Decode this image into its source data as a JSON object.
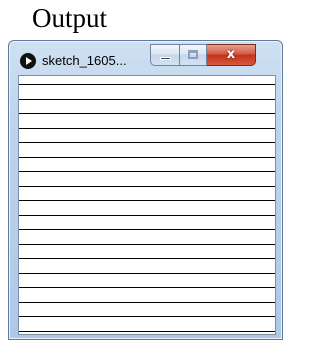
{
  "page": {
    "heading": "Output"
  },
  "window": {
    "title": "sketch_1605...",
    "app_icon": "play-icon",
    "buttons": {
      "minimize_icon": "minimize-icon",
      "maximize_icon": "maximize-icon",
      "close_label": "x"
    }
  },
  "canvas": {
    "background": "#ffffff",
    "line_color": "#000000",
    "line_count": 18
  }
}
